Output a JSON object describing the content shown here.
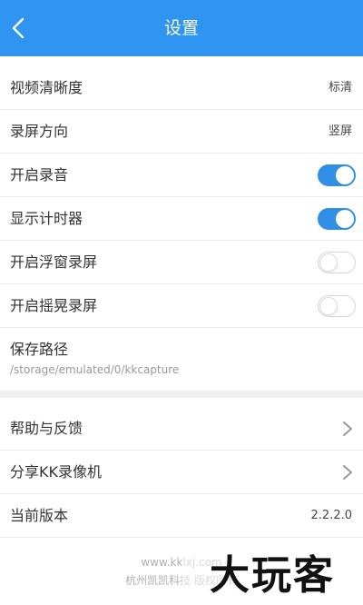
{
  "header": {
    "title": "设置"
  },
  "settings": {
    "video_quality": {
      "label": "视频清晰度",
      "value": "标清"
    },
    "orientation": {
      "label": "录屏方向",
      "value": "竖屏"
    },
    "record_audio": {
      "label": "开启录音",
      "enabled": true
    },
    "show_timer": {
      "label": "显示计时器",
      "enabled": true
    },
    "floating_window": {
      "label": "开启浮窗录屏",
      "enabled": false
    },
    "shake_record": {
      "label": "开启摇晃录屏",
      "enabled": false
    },
    "save_path": {
      "label": "保存路径",
      "value": "/storage/emulated/0/kkcapture"
    }
  },
  "more": {
    "help": {
      "label": "帮助与反馈"
    },
    "share": {
      "label": "分享KK录像机"
    },
    "version": {
      "label": "当前版本",
      "value": "2.2.2.0"
    }
  },
  "footer": {
    "url": "www.kklxj.com",
    "company": "杭州凯凯科技 版权所有"
  },
  "watermark": "大玩客",
  "colors": {
    "header_bg": "#2f95f0",
    "toggle_on": "#2f8fe6"
  }
}
